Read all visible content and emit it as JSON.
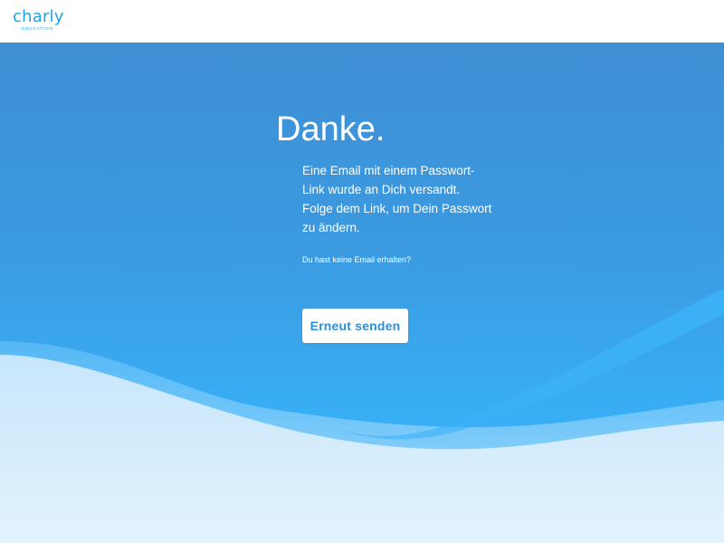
{
  "brand": {
    "name": "charly",
    "tagline": "EDUCATION",
    "color": "#1aa3e8"
  },
  "confirmation": {
    "title": "Danke.",
    "message_lines": [
      "Eine Email mit einem Passwort-",
      "Link wurde an Dich versandt.",
      "Folge dem Link, um Dein Passwort",
      "zu ändern."
    ],
    "no_email_link": "Du hast keine Email erhalten?",
    "resend_button": "Erneut senden"
  },
  "colors": {
    "hero_top": "#3f8fd4",
    "hero_bottom": "#38aef5",
    "wave_light": "#d9eefc",
    "button_text": "#2e8fd8"
  }
}
